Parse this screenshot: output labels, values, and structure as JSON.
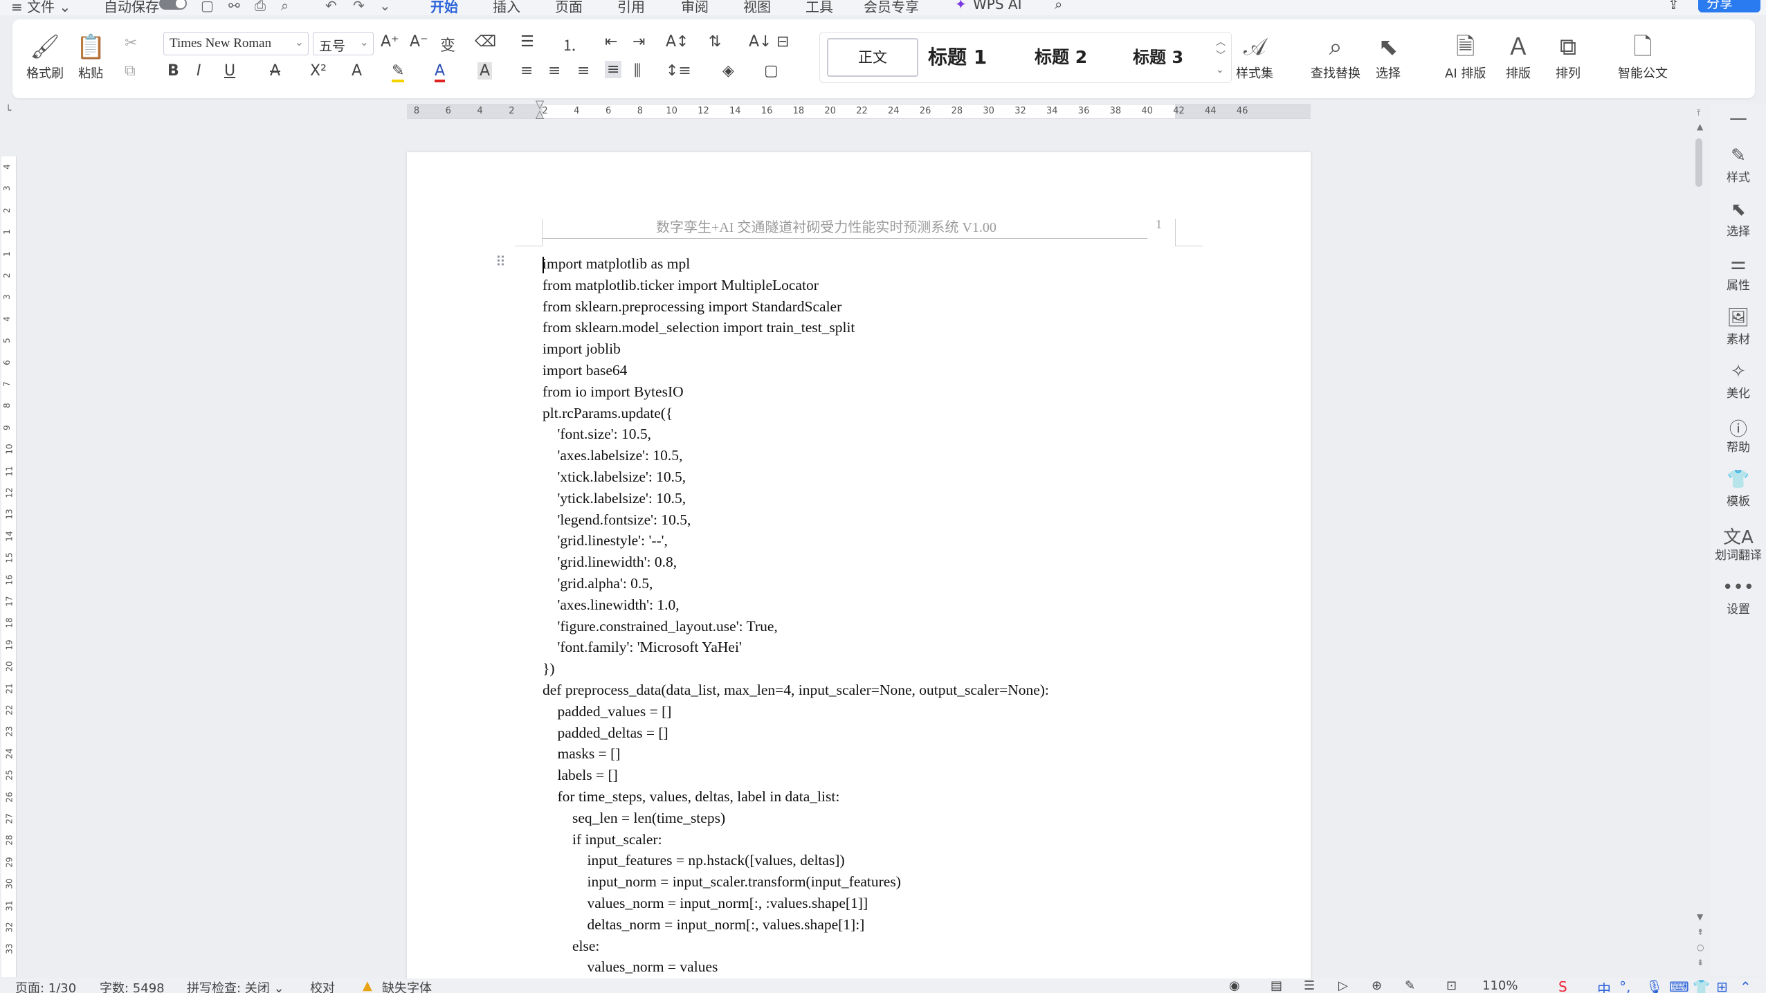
{
  "menubar": {
    "file": "≡ 文件 ⌄",
    "autosave": "自动保存",
    "tabs": [
      "开始",
      "插入",
      "页面",
      "引用",
      "审阅",
      "视图",
      "工具",
      "会员专享",
      "WPS AI"
    ],
    "active_tab": "开始",
    "share": "分享"
  },
  "ribbon": {
    "format_painter": "格式刷",
    "paste": "粘贴",
    "font_name": "Times New Roman",
    "font_size": "五号",
    "styles": {
      "normal": "正文",
      "heading1": "标题 1",
      "heading2": "标题 2",
      "heading3": "标题 3"
    },
    "style_set": "样式集",
    "find_replace": "查找替换",
    "select": "选择",
    "ai_layout": "AI 排版",
    "typeset": "排版",
    "arrange": "排列",
    "smart_doc": "智能公文"
  },
  "ruler": {
    "numbers": [
      "8",
      "6",
      "4",
      "2",
      "2",
      "4",
      "6",
      "8",
      "10",
      "12",
      "14",
      "16",
      "18",
      "20",
      "22",
      "24",
      "26",
      "28",
      "30",
      "32",
      "34",
      "36",
      "38",
      "40",
      "42",
      "44",
      "46"
    ],
    "vertical_numbers": [
      "4",
      "3",
      "2",
      "1",
      "1",
      "2",
      "3",
      "4",
      "5",
      "6",
      "7",
      "8",
      "9",
      "10",
      "11",
      "12",
      "13",
      "14",
      "15",
      "16",
      "17",
      "18",
      "19",
      "20",
      "21",
      "22",
      "23",
      "24",
      "25",
      "26",
      "27",
      "28",
      "29",
      "30",
      "31",
      "32",
      "33"
    ]
  },
  "document": {
    "header_title": "数字孪生+AI 交通隧道衬砌受力性能实时预测系统  V1.00",
    "page_number": "1",
    "code_lines": [
      "import matplotlib as mpl",
      "from matplotlib.ticker import MultipleLocator",
      "from sklearn.preprocessing import StandardScaler",
      "from sklearn.model_selection import train_test_split",
      "import joblib",
      "import base64",
      "from io import BytesIO",
      "plt.rcParams.update({",
      "    'font.size': 10.5,",
      "    'axes.labelsize': 10.5,",
      "    'xtick.labelsize': 10.5,",
      "    'ytick.labelsize': 10.5,",
      "    'legend.fontsize': 10.5,",
      "    'grid.linestyle': '--',",
      "    'grid.linewidth': 0.8,",
      "    'grid.alpha': 0.5,",
      "    'axes.linewidth': 1.0,",
      "    'figure.constrained_layout.use': True,",
      "    'font.family': 'Microsoft YaHei'",
      "})",
      "def preprocess_data(data_list, max_len=4, input_scaler=None, output_scaler=None):",
      "    padded_values = []",
      "    padded_deltas = []",
      "    masks = []",
      "    labels = []",
      "    for time_steps, values, deltas, label in data_list:",
      "        seq_len = len(time_steps)",
      "        if input_scaler:",
      "            input_features = np.hstack([values, deltas])",
      "            input_norm = input_scaler.transform(input_features)",
      "            values_norm = input_norm[:, :values.shape[1]]",
      "            deltas_norm = input_norm[:, values.shape[1]:]",
      "        else:",
      "            values_norm = values"
    ]
  },
  "sidepanel": [
    "样式",
    "选择",
    "属性",
    "素材",
    "美化",
    "帮助",
    "模板",
    "划词翻译",
    "设置"
  ],
  "statusbar": {
    "page": "页面: 1/30",
    "words": "字数: 5498",
    "spellcheck": "拼写检查: 关闭 ⌄",
    "proofread": "校对",
    "missing_font": "缺失字体",
    "zoom": "110%"
  }
}
